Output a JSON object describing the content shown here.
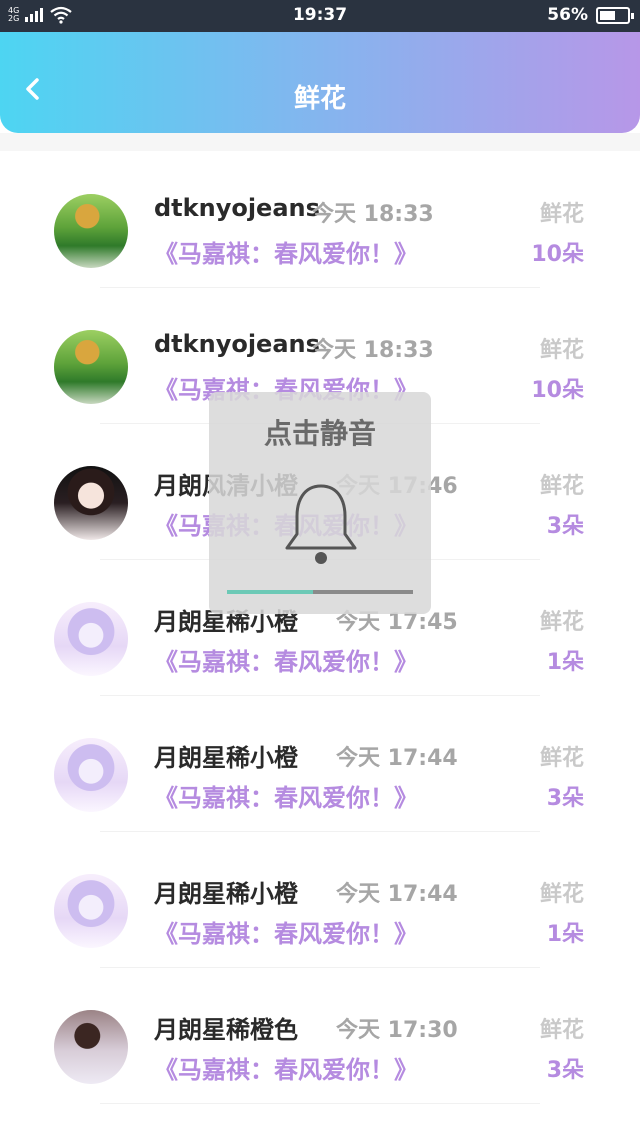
{
  "status_bar": {
    "network_top": "4G",
    "network_bottom": "2G",
    "time": "19:37",
    "battery_pct": "56%",
    "battery_level": 0.56
  },
  "header": {
    "title": "鲜花",
    "colors": {
      "gradient_start": "#4dd5f2",
      "gradient_end": "#b797e8"
    }
  },
  "overlay": {
    "label": "点击静音",
    "volume_level": 0.46,
    "icon": "bell-icon"
  },
  "rows": [
    {
      "name": "dtknyojeans",
      "time": "今天 18:33",
      "song": "《马嘉祺：春风爱你！》",
      "gift": "鲜花",
      "count": "10朵"
    },
    {
      "name": "dtknyojeans",
      "time": "今天 18:33",
      "song": "《马嘉祺：春风爱你！》",
      "gift": "鲜花",
      "count": "10朵"
    },
    {
      "name": "月朗风清小橙",
      "time": "今天 17:46",
      "song": "《马嘉祺：春风爱你！》",
      "gift": "鲜花",
      "count": "3朵"
    },
    {
      "name": "月朗星稀小橙",
      "time": "今天 17:45",
      "song": "《马嘉祺：春风爱你！》",
      "gift": "鲜花",
      "count": "1朵"
    },
    {
      "name": "月朗星稀小橙",
      "time": "今天 17:44",
      "song": "《马嘉祺：春风爱你！》",
      "gift": "鲜花",
      "count": "3朵"
    },
    {
      "name": "月朗星稀小橙",
      "time": "今天 17:44",
      "song": "《马嘉祺：春风爱你！》",
      "gift": "鲜花",
      "count": "1朵"
    },
    {
      "name": "月朗星稀橙色",
      "time": "今天 17:30",
      "song": "《马嘉祺：春风爱你！》",
      "gift": "鲜花",
      "count": "3朵"
    }
  ]
}
